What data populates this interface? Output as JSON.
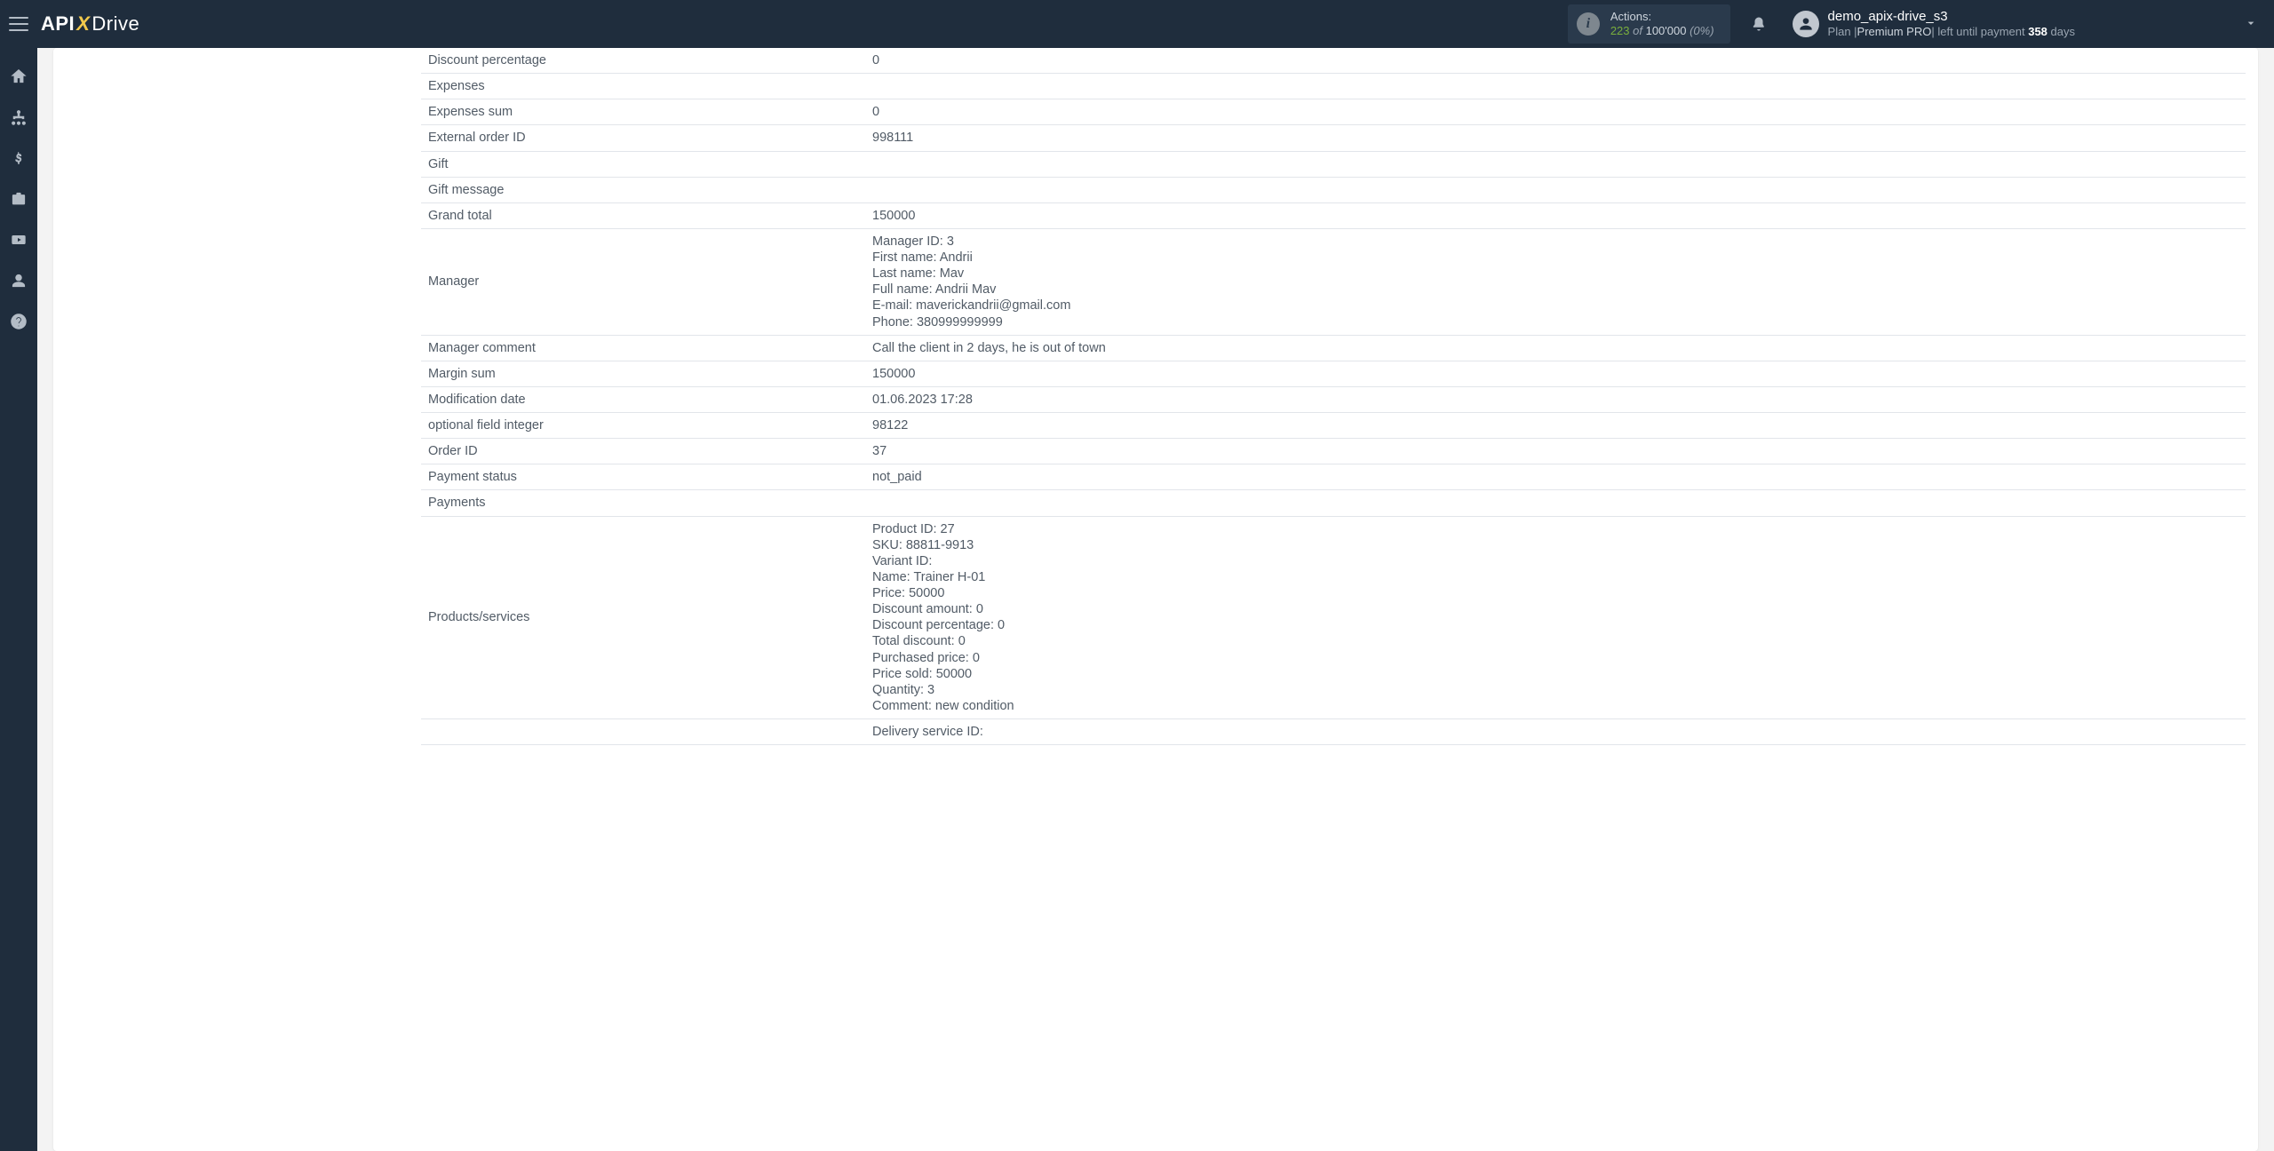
{
  "header": {
    "logo_api": "API",
    "logo_x": "X",
    "logo_drive": "Drive",
    "actions_title": "Actions:",
    "actions_count": "223",
    "actions_of": " of ",
    "actions_limit": "100'000",
    "actions_pct": " (0%)",
    "username": "demo_apix-drive_s3",
    "plan_prefix": "Plan  |",
    "plan_name": "Premium PRO",
    "plan_sep": "|  left until payment ",
    "plan_days": "358",
    "plan_days_suffix": " days"
  },
  "rows": [
    {
      "label": "Discount percentage",
      "value": "0"
    },
    {
      "label": "Expenses",
      "value": ""
    },
    {
      "label": "Expenses sum",
      "value": "0"
    },
    {
      "label": "External order ID",
      "value": "998111"
    },
    {
      "label": "Gift",
      "value": ""
    },
    {
      "label": "Gift message",
      "value": ""
    },
    {
      "label": "Grand total",
      "value": "150000"
    },
    {
      "label": "Manager",
      "value": "Manager ID: 3\nFirst name: Andrii\nLast name: Mav\nFull name: Andrii Mav\nE-mail: maverickandrii@gmail.com\nPhone: 380999999999"
    },
    {
      "label": "Manager comment",
      "value": "Call the client in 2 days, he is out of town"
    },
    {
      "label": "Margin sum",
      "value": "150000"
    },
    {
      "label": "Modification date",
      "value": "01.06.2023 17:28"
    },
    {
      "label": "optional field integer",
      "value": "98122"
    },
    {
      "label": "Order ID",
      "value": "37"
    },
    {
      "label": "Payment status",
      "value": "not_paid"
    },
    {
      "label": "Payments",
      "value": ""
    },
    {
      "label": "Products/services",
      "value": "Product ID: 27\nSKU: 88811-9913\nVariant ID:\nName: Trainer H-01\nPrice: 50000\nDiscount amount: 0\nDiscount percentage: 0\nTotal discount: 0\nPurchased price: 0\nPrice sold: 50000\nQuantity: 3\nComment: new condition"
    },
    {
      "label": "",
      "value": "Delivery service ID:"
    }
  ]
}
